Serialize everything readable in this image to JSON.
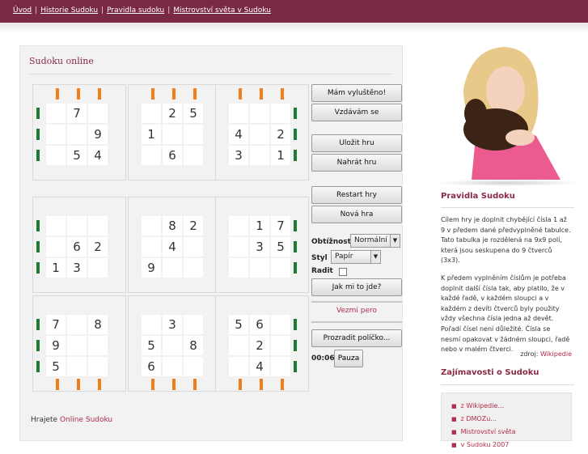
{
  "nav": {
    "items": [
      "Úvod",
      "Historie Sudoku",
      "Pravidla sudoku",
      "Mistrovství světa v Sudoku"
    ],
    "separator": "|"
  },
  "panel": {
    "title": "Sudoku online"
  },
  "grid": {
    "rows": [
      [
        "",
        "7",
        "",
        "",
        "2",
        "5",
        "",
        "",
        ""
      ],
      [
        "",
        "",
        "9",
        "1",
        "",
        "",
        "4",
        "",
        "2"
      ],
      [
        "",
        "5",
        "4",
        "",
        "6",
        "",
        "3",
        "",
        "1"
      ],
      [
        "",
        "",
        "",
        "",
        "8",
        "2",
        "",
        "1",
        "7"
      ],
      [
        "",
        "6",
        "2",
        "",
        "4",
        "",
        "",
        "3",
        "5"
      ],
      [
        "1",
        "3",
        "",
        "9",
        "",
        "",
        "",
        "",
        ""
      ],
      [
        "7",
        "",
        "8",
        "",
        "3",
        "",
        "5",
        "6",
        ""
      ],
      [
        "9",
        "",
        "",
        "5",
        "",
        "8",
        "",
        "2",
        ""
      ],
      [
        "5",
        "",
        "",
        "6",
        "",
        "",
        "",
        "4",
        ""
      ]
    ]
  },
  "controls": {
    "solved": "Mám vyluštěno!",
    "give_up": "Vzdávám se",
    "save": "Uložit hru",
    "load": "Nahrát hru",
    "restart": "Restart hry",
    "new_game": "Nová hra",
    "difficulty_label": "Obtížnost",
    "difficulty_value": "Normální",
    "style_label": "Styl",
    "style_value": "Papír",
    "advise_label": "Radit",
    "how_am_i_doing": "Jak mi to jde?",
    "eraser": "Vezmi pero",
    "reveal_cell": "Prozradit políčko...",
    "timer": "00:06",
    "pause": "Pauza"
  },
  "footer": {
    "prefix": "Hrajete",
    "link": "Online Sudoku"
  },
  "sidebar": {
    "rules_title": "Pravidla Sudoku",
    "rules_p1": "Cílem hry je doplnit chybějící čísla 1 až 9 v předem dané předvyplněné tabulce. Tato tabulka je rozdělená na 9x9 polí, která jsou seskupena do 9 čtverců (3x3).",
    "rules_p2": "K předem vyplněním číslům je potřeba doplnit další čísla tak, aby platilo, že v každé řadě, v každém sloupci a v každém z devíti čtverců byly použity vždy všechna čísla jedna až devět. Pořadí čísel není důležité. Čísla se nesmí opakovat v žádném sloupci, řadě nebo v malém čtverci.",
    "source_prefix": "zdroj:",
    "source_link": "Wikipedie",
    "facts_title": "Zajímavosti o Sudoku",
    "links": [
      "z Wikipedie...",
      "z DMOZu...",
      "Mistrovství světa",
      "v Sudoku 2007"
    ]
  },
  "colors": {
    "brand": "#7a2942",
    "accent_link": "#b02c4a",
    "orange_marker": "#ef7f1a",
    "green_marker": "#1e7b34"
  }
}
